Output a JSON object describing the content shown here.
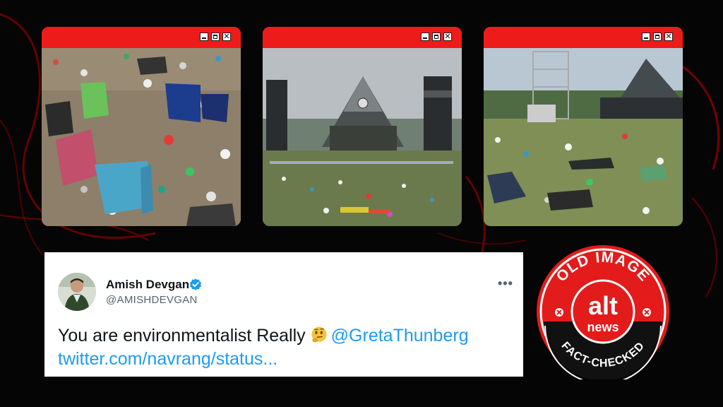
{
  "photos": [
    {
      "id": "photo-1",
      "scene": "littered field with abandoned camping chairs"
    },
    {
      "id": "photo-2",
      "scene": "pyramid stage with litter-covered field"
    },
    {
      "id": "photo-3",
      "scene": "pyramid stage and scaffolding tower over littered field"
    }
  ],
  "window_controls": {
    "close_glyph": "✕"
  },
  "tweet": {
    "display_name": "Amish Devgan",
    "handle": "@AMISHDEVGAN",
    "more": "•••",
    "text": "You are environmentalist Really",
    "mention": "@GretaThunberg",
    "link": "twitter.com/navrang/status..."
  },
  "badge": {
    "top_text": "OLD IMAGE",
    "logo_top": "alt",
    "logo_bottom": "news",
    "bottom_text": "FACT-CHECKED"
  },
  "colors": {
    "accent_red": "#ee1b1b",
    "badge_red": "#e31b1b",
    "link_blue": "#1d9bf0",
    "verified_blue": "#1d9bf0"
  }
}
